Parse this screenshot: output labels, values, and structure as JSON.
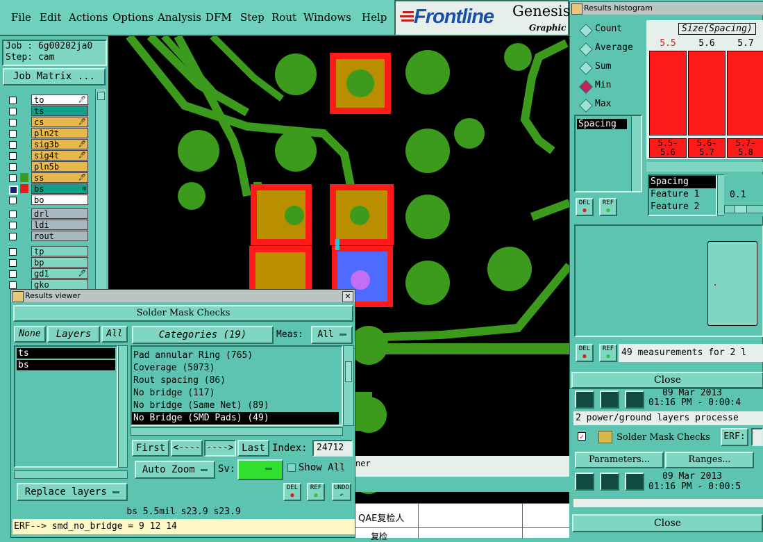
{
  "menu": [
    "File",
    "Edit",
    "Actions",
    "Options",
    "Analysis",
    "DFM",
    "Step",
    "Rout",
    "Windows",
    "Help"
  ],
  "brand": {
    "logo": "Frontline",
    "product": "Genesis",
    "subtitle": "Graphic"
  },
  "job": {
    "job_label": "Job : 6g00202ja0",
    "step_label": "Step: cam",
    "matrix_button": "Job Matrix ..."
  },
  "layers": [
    {
      "name": "to",
      "bg": "#ffffff",
      "mark": "🖊"
    },
    {
      "name": "ts",
      "bg": "#13a089",
      "mark": ""
    },
    {
      "name": "cs",
      "bg": "#e8b84a",
      "mark": "🖊"
    },
    {
      "name": "pln2t",
      "bg": "#e8b84a",
      "mark": ""
    },
    {
      "name": "sig3b",
      "bg": "#e8b84a",
      "mark": "🖊"
    },
    {
      "name": "sig4t",
      "bg": "#e8b84a",
      "mark": "🖊"
    },
    {
      "name": "pln5b",
      "bg": "#e8b84a",
      "mark": ""
    },
    {
      "name": "ss",
      "bg": "#e8b84a",
      "mark": "🖊"
    },
    {
      "name": "bs",
      "bg": "#13a089",
      "mark": "⊞"
    },
    {
      "name": "bo",
      "bg": "#ffffff",
      "mark": ""
    },
    {
      "name": "drl",
      "bg": "#a9b9c2",
      "mark": ""
    },
    {
      "name": "ldi",
      "bg": "#a9b9c2",
      "mark": ""
    },
    {
      "name": "rout",
      "bg": "#a9b9c2",
      "mark": ""
    },
    {
      "name": "tp",
      "bg": "#7fd6c3",
      "mark": ""
    },
    {
      "name": "bp",
      "bg": "#7fd6c3",
      "mark": ""
    },
    {
      "name": "gd1",
      "bg": "#7fd6c3",
      "mark": "🖊"
    },
    {
      "name": "gko",
      "bg": "#7fd6c3",
      "mark": ""
    }
  ],
  "viewer": {
    "title": "Results viewer",
    "header": "Solder Mask Checks",
    "none_btn": "None",
    "layers_btn": "Layers",
    "all_btn": "All",
    "layers": [
      "ts",
      "bs"
    ],
    "categories_btn": "Categories (19)",
    "meas_label": "Meas:",
    "meas_value": "All",
    "categories": [
      "Pad annular Ring (765)",
      "Coverage (5073)",
      "Rout spacing (86)",
      "No bridge (117)",
      "No bridge (Same Net) (89)",
      "No Bridge (SMD Pads) (49)"
    ],
    "first": "First",
    "prev": "<----",
    "next": "---->",
    "last": "Last",
    "index_label": "Index:",
    "index_value": "24712",
    "auto_zoom": "Auto Zoom",
    "sv_label": "Sv:",
    "show_all": "Show All",
    "replace_layers": "Replace layers",
    "del": "DEL",
    "ref": "REF",
    "undo": "UNDO",
    "status": "bs 5.5mil  s23.9  s23.9",
    "erf": "ERF--> smd_no_bridge = 9 12 14"
  },
  "histogram": {
    "title": "Results histogram",
    "options": [
      "Count",
      "Average",
      "Sum",
      "Min",
      "Max"
    ],
    "list_item": "Spacing",
    "chart_title": "Size(Spacing)",
    "bars": [
      {
        "top": "5.5",
        "low": "5.5-",
        "high": "5.6",
        "color": "#d82020"
      },
      {
        "top": "5.6",
        "low": "5.6-",
        "high": "5.7",
        "color": "#000"
      },
      {
        "top": "5.7",
        "low": "5.7-",
        "high": "5.8",
        "color": "#000"
      }
    ],
    "feature_list": [
      "Spacing",
      "Feature 1",
      "Feature 2"
    ],
    "step_value": "0.1",
    "del": "DEL",
    "ref": "REF",
    "measurements": "49 measurements for 2 l",
    "close": "Close"
  },
  "background_panel": {
    "date1": "09 Mar 2013",
    "time1": "01:16 PM - 0:00:4",
    "processed": "2 power/ground layers processe",
    "solder": "Solder Mask Checks",
    "erf": "ERF:",
    "parameters": "Parameters...",
    "ranges": "Ranges...",
    "date2": "09 Mar 2013",
    "time2": "01:16 PM - 0:00:5",
    "close": "Close"
  },
  "misc": {
    "ner": "ner",
    "qae": "QAE复检人",
    "fujian": "复检"
  }
}
